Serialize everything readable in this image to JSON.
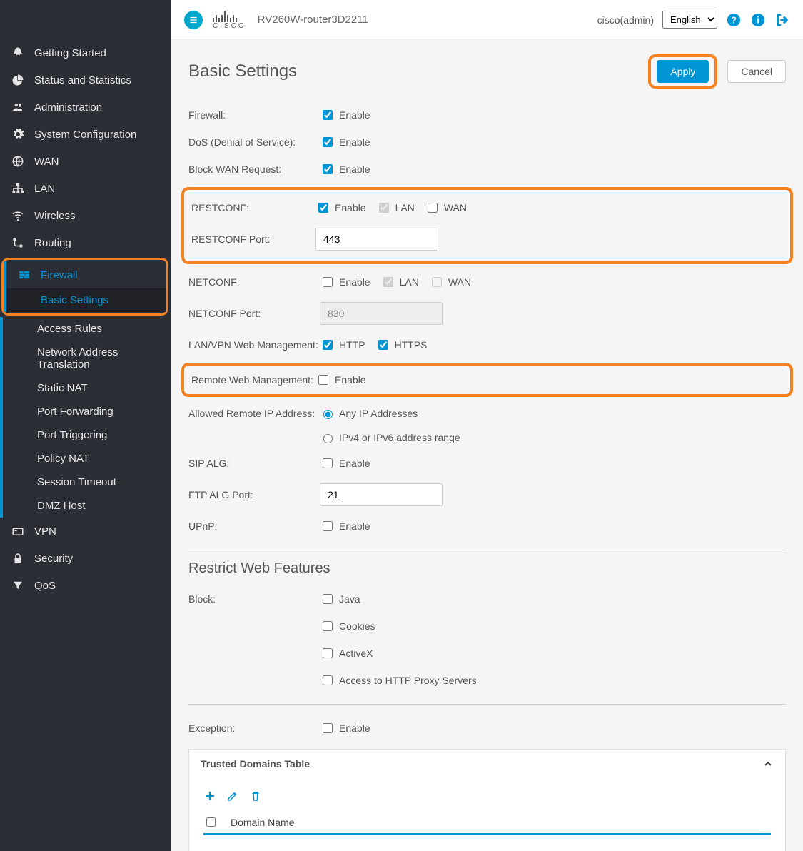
{
  "header": {
    "device_name": "RV260W-router3D2211",
    "user": "cisco(admin)",
    "language": "English",
    "cisco_text": "CISCO"
  },
  "sidebar": {
    "items": [
      {
        "label": "Getting Started",
        "icon": "rocket"
      },
      {
        "label": "Status and Statistics",
        "icon": "chart-pie"
      },
      {
        "label": "Administration",
        "icon": "users"
      },
      {
        "label": "System Configuration",
        "icon": "gear"
      },
      {
        "label": "WAN",
        "icon": "globe"
      },
      {
        "label": "LAN",
        "icon": "sitemap"
      },
      {
        "label": "Wireless",
        "icon": "wifi"
      },
      {
        "label": "Routing",
        "icon": "route"
      }
    ],
    "firewall": {
      "label": "Firewall",
      "children": [
        "Basic Settings",
        "Access Rules",
        "Network Address Translation",
        "Static NAT",
        "Port Forwarding",
        "Port Triggering",
        "Policy NAT",
        "Session Timeout",
        "DMZ Host"
      ]
    },
    "tail": [
      {
        "label": "VPN",
        "icon": "vpn"
      },
      {
        "label": "Security",
        "icon": "lock"
      },
      {
        "label": "QoS",
        "icon": "filter"
      }
    ]
  },
  "page": {
    "title": "Basic Settings",
    "apply": "Apply",
    "cancel": "Cancel"
  },
  "form": {
    "firewall": {
      "label": "Firewall:",
      "enable": "Enable"
    },
    "dos": {
      "label": "DoS (Denial of Service):",
      "enable": "Enable"
    },
    "blockwan": {
      "label": "Block WAN Request:",
      "enable": "Enable"
    },
    "restconf": {
      "label": "RESTCONF:",
      "enable": "Enable",
      "lan": "LAN",
      "wan": "WAN"
    },
    "restconf_port": {
      "label": "RESTCONF Port:",
      "value": "443"
    },
    "netconf": {
      "label": "NETCONF:",
      "enable": "Enable",
      "lan": "LAN",
      "wan": "WAN"
    },
    "netconf_port": {
      "label": "NETCONF Port:",
      "value": "830"
    },
    "lanvpn": {
      "label": "LAN/VPN Web Management:",
      "http": "HTTP",
      "https": "HTTPS"
    },
    "remote": {
      "label": "Remote Web Management:",
      "enable": "Enable"
    },
    "allowed_ip": {
      "label": "Allowed Remote IP Address:",
      "any": "Any IP Addresses",
      "range": "IPv4 or IPv6 address range"
    },
    "sip_alg": {
      "label": "SIP ALG:",
      "enable": "Enable"
    },
    "ftp_alg": {
      "label": "FTP ALG Port:",
      "value": "21"
    },
    "upnp": {
      "label": "UPnP:",
      "enable": "Enable"
    }
  },
  "restrict": {
    "title": "Restrict Web Features",
    "block_label": "Block:",
    "java": "Java",
    "cookies": "Cookies",
    "activex": "ActiveX",
    "proxy": "Access to HTTP Proxy Servers",
    "exception_label": "Exception:",
    "exception_enable": "Enable"
  },
  "trusted": {
    "title": "Trusted Domains Table",
    "col": "Domain Name"
  }
}
